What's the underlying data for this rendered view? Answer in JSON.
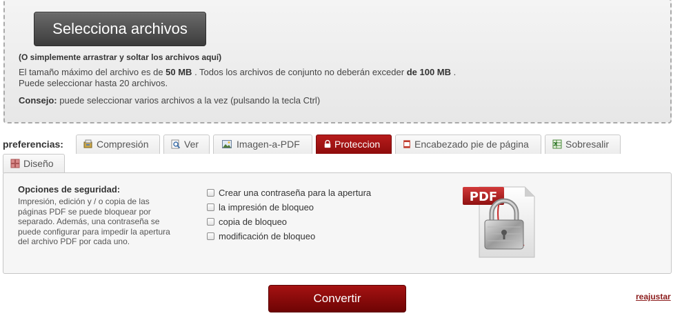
{
  "upload": {
    "select_label": "Selecciona archivos",
    "drag_hint": "(O simplemente arrastrar y soltar los archivos aquí)",
    "size_prefix": "El tamaño máximo del archivo es de ",
    "max_file": "50 MB",
    "size_mid": " . Todos los archivos de conjunto no deberán exceder ",
    "max_total": "de 100 MB",
    "size_suffix": " .",
    "file_limit": "Puede seleccionar hasta 20 archivos.",
    "tip_label": "Consejo:",
    "tip_text": " puede seleccionar varios archivos a la vez (pulsando la tecla Ctrl)"
  },
  "preferences": {
    "label": "preferencias:",
    "tabs": [
      {
        "label": "Compresión",
        "icon": "compress-icon",
        "active": false
      },
      {
        "label": "Ver",
        "icon": "magnifier-icon",
        "active": false
      },
      {
        "label": "Imagen-a-PDF",
        "icon": "image-icon",
        "active": false
      },
      {
        "label": "Proteccion",
        "icon": "lock-icon",
        "active": true
      },
      {
        "label": "Encabezado pie de página",
        "icon": "page-icon",
        "active": false
      },
      {
        "label": "Sobresalir",
        "icon": "excel-icon",
        "active": false
      },
      {
        "label": "Diseño",
        "icon": "layout-icon",
        "active": false
      }
    ]
  },
  "security": {
    "title": "Opciones de seguridad:",
    "description": "Impresión, edición y / o copia de las páginas PDF se puede bloquear por separado. Además, una contraseña se puede configurar para impedir la apertura del archivo PDF por cada uno.",
    "options": [
      {
        "label": "Crear una contraseña para la apertura",
        "checked": false
      },
      {
        "label": "la impresión de bloqueo",
        "checked": false
      },
      {
        "label": "copia de bloqueo",
        "checked": false
      },
      {
        "label": "modificación de bloqueo",
        "checked": false
      }
    ],
    "badge_text": "PDF"
  },
  "actions": {
    "convert_label": "Convertir",
    "reset_label": "reajustar"
  },
  "colors": {
    "accent": "#a51212",
    "tab_active": "#b71c1c",
    "select_button": "#4a4a4a",
    "reset_link": "#8b1a1a"
  }
}
